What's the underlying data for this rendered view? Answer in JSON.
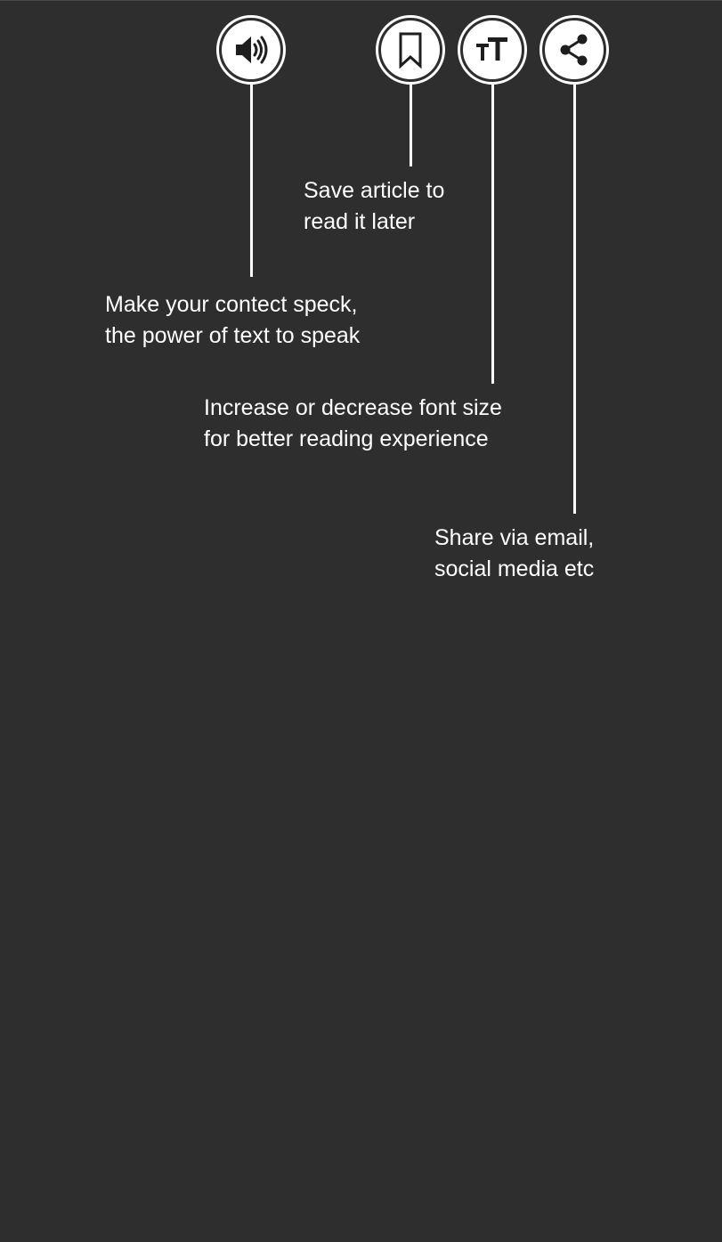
{
  "colors": {
    "background": "#2e2e2e",
    "foreground": "#ffffff",
    "icon_fill": "#1e1e1e"
  },
  "toolbar": {
    "buttons": [
      {
        "id": "speak",
        "icon": "speaker-icon"
      },
      {
        "id": "bookmark",
        "icon": "bookmark-icon"
      },
      {
        "id": "font-size",
        "icon": "font-size-icon",
        "glyph": "TT"
      },
      {
        "id": "share",
        "icon": "share-icon"
      }
    ]
  },
  "tooltips": {
    "bookmark": {
      "line1": "Save article to",
      "line2": "read it later"
    },
    "speak": {
      "line1": "Make your contect speck,",
      "line2": "the power of text to speak"
    },
    "font_size": {
      "line1": "Increase or decrease font size",
      "line2": "for better reading experience"
    },
    "share": {
      "line1": "Share via email,",
      "line2": "social media etc"
    }
  }
}
